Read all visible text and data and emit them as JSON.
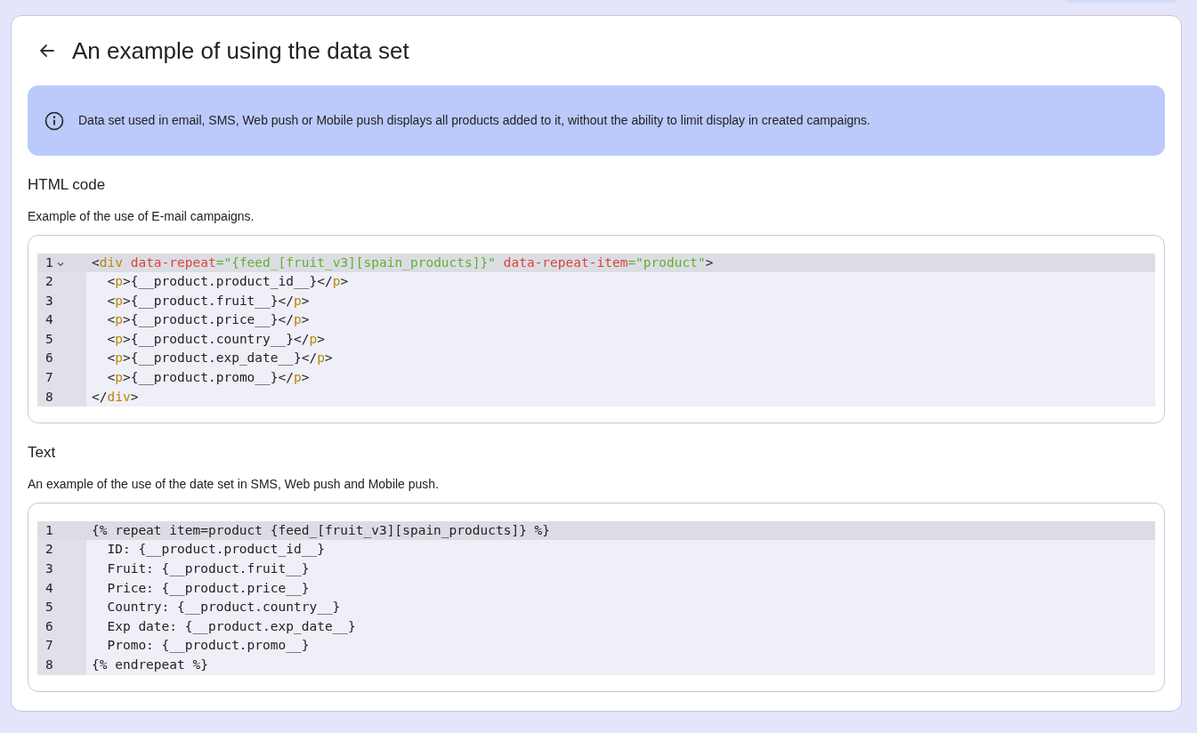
{
  "page": {
    "title": "An example of using the data set"
  },
  "info_banner": {
    "text": "Data set used in email, SMS, Web push or Mobile push displays all products added to it, without the ability to limit display in created campaigns."
  },
  "sections": [
    {
      "title": "HTML code",
      "description": "Example of the use of E-mail campaigns.",
      "lines": [
        {
          "number": "1",
          "active": true,
          "foldable": true,
          "tokens": [
            {
              "kind": "plain",
              "text": "<"
            },
            {
              "kind": "tag",
              "text": "div"
            },
            {
              "kind": "attr",
              "text": " data-repeat"
            },
            {
              "kind": "string",
              "text": "=\"{feed_[fruit_v3][spain_products]}\""
            },
            {
              "kind": "attr",
              "text": " data-repeat-item"
            },
            {
              "kind": "string",
              "text": "=\"product\""
            },
            {
              "kind": "plain",
              "text": ">"
            }
          ]
        },
        {
          "number": "2",
          "active": false,
          "foldable": false,
          "tokens": [
            {
              "kind": "plain",
              "text": "  <"
            },
            {
              "kind": "tag",
              "text": "p"
            },
            {
              "kind": "plain",
              "text": ">{__product.product_id__}</"
            },
            {
              "kind": "tag",
              "text": "p"
            },
            {
              "kind": "plain",
              "text": ">"
            }
          ]
        },
        {
          "number": "3",
          "active": false,
          "foldable": false,
          "tokens": [
            {
              "kind": "plain",
              "text": "  <"
            },
            {
              "kind": "tag",
              "text": "p"
            },
            {
              "kind": "plain",
              "text": ">{__product.fruit__}</"
            },
            {
              "kind": "tag",
              "text": "p"
            },
            {
              "kind": "plain",
              "text": ">"
            }
          ]
        },
        {
          "number": "4",
          "active": false,
          "foldable": false,
          "tokens": [
            {
              "kind": "plain",
              "text": "  <"
            },
            {
              "kind": "tag",
              "text": "p"
            },
            {
              "kind": "plain",
              "text": ">{__product.price__}</"
            },
            {
              "kind": "tag",
              "text": "p"
            },
            {
              "kind": "plain",
              "text": ">"
            }
          ]
        },
        {
          "number": "5",
          "active": false,
          "foldable": false,
          "tokens": [
            {
              "kind": "plain",
              "text": "  <"
            },
            {
              "kind": "tag",
              "text": "p"
            },
            {
              "kind": "plain",
              "text": ">{__product.country__}</"
            },
            {
              "kind": "tag",
              "text": "p"
            },
            {
              "kind": "plain",
              "text": ">"
            }
          ]
        },
        {
          "number": "6",
          "active": false,
          "foldable": false,
          "tokens": [
            {
              "kind": "plain",
              "text": "  <"
            },
            {
              "kind": "tag",
              "text": "p"
            },
            {
              "kind": "plain",
              "text": ">{__product.exp_date__}</"
            },
            {
              "kind": "tag",
              "text": "p"
            },
            {
              "kind": "plain",
              "text": ">"
            }
          ]
        },
        {
          "number": "7",
          "active": false,
          "foldable": false,
          "tokens": [
            {
              "kind": "plain",
              "text": "  <"
            },
            {
              "kind": "tag",
              "text": "p"
            },
            {
              "kind": "plain",
              "text": ">{__product.promo__}</"
            },
            {
              "kind": "tag",
              "text": "p"
            },
            {
              "kind": "plain",
              "text": ">"
            }
          ]
        },
        {
          "number": "8",
          "active": false,
          "foldable": false,
          "tokens": [
            {
              "kind": "plain",
              "text": "</"
            },
            {
              "kind": "tag",
              "text": "div"
            },
            {
              "kind": "plain",
              "text": ">"
            }
          ]
        }
      ]
    },
    {
      "title": "Text",
      "description": "An example of the use of the date set in SMS, Web push and Mobile push.",
      "lines": [
        {
          "number": "1",
          "active": true,
          "foldable": false,
          "tokens": [
            {
              "kind": "plain",
              "text": "{% repeat item=product {feed_[fruit_v3][spain_products]} %}"
            }
          ]
        },
        {
          "number": "2",
          "active": false,
          "foldable": false,
          "tokens": [
            {
              "kind": "plain",
              "text": "  ID: {__product.product_id__}"
            }
          ]
        },
        {
          "number": "3",
          "active": false,
          "foldable": false,
          "tokens": [
            {
              "kind": "plain",
              "text": "  Fruit: {__product.fruit__}"
            }
          ]
        },
        {
          "number": "4",
          "active": false,
          "foldable": false,
          "tokens": [
            {
              "kind": "plain",
              "text": "  Price: {__product.price__}"
            }
          ]
        },
        {
          "number": "5",
          "active": false,
          "foldable": false,
          "tokens": [
            {
              "kind": "plain",
              "text": "  Country: {__product.country__}"
            }
          ]
        },
        {
          "number": "6",
          "active": false,
          "foldable": false,
          "tokens": [
            {
              "kind": "plain",
              "text": "  Exp date: {__product.exp_date__}"
            }
          ]
        },
        {
          "number": "7",
          "active": false,
          "foldable": false,
          "tokens": [
            {
              "kind": "plain",
              "text": "  Promo: {__product.promo__}"
            }
          ]
        },
        {
          "number": "8",
          "active": false,
          "foldable": false,
          "tokens": [
            {
              "kind": "plain",
              "text": "{% endrepeat %}"
            }
          ]
        }
      ]
    }
  ]
}
